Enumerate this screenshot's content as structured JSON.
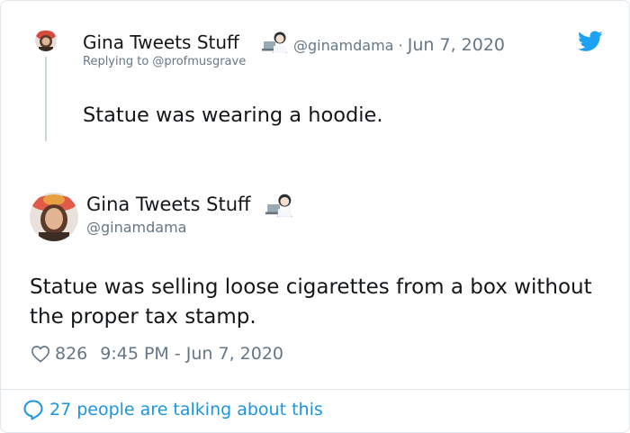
{
  "reply_tweet": {
    "author_name": "Gina Tweets Stuff",
    "handle": "@ginamdama",
    "separator": "·",
    "date": "Jun 7, 2020",
    "replying_to": "Replying to @profmusgrave",
    "text": "Statue was wearing a hoodie.",
    "emoji_icon": "woman-technologist-icon",
    "brand_icon": "twitter-bird-icon"
  },
  "main_tweet": {
    "author_name": "Gina Tweets Stuff",
    "handle": "@ginamdama",
    "emoji_icon": "woman-technologist-icon",
    "text": "Statue was selling loose cigarettes from a box without the proper tax stamp.",
    "likes": "826",
    "timestamp": "9:45 PM - Jun 7, 2020"
  },
  "footer": {
    "talking_text": "27 people are talking about this"
  },
  "colors": {
    "twitter_blue": "#1da1f2",
    "link_blue": "#1b95e0",
    "muted_gray": "#657786",
    "text_dark": "#14171a",
    "border": "#e1e8ed"
  }
}
